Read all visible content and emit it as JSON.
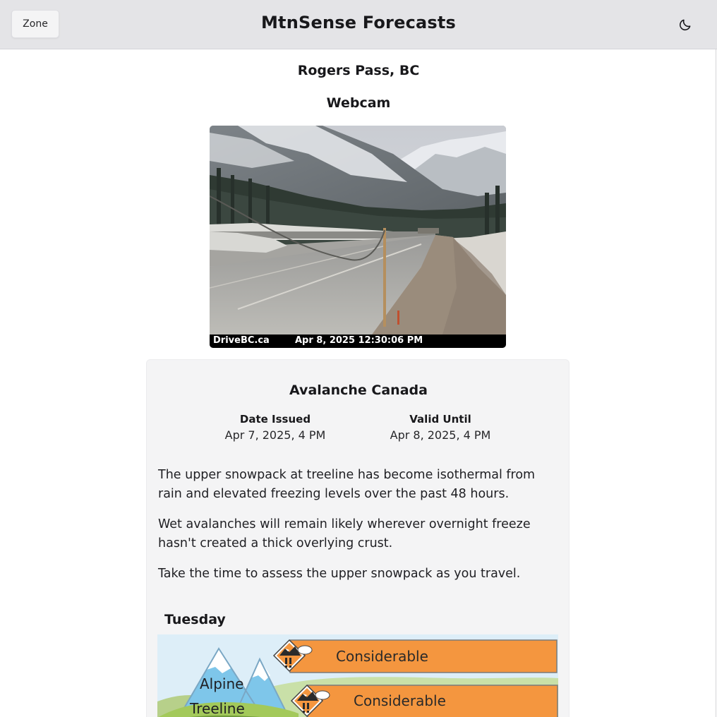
{
  "header": {
    "zone_button": "Zone",
    "title": "MtnSense Forecasts",
    "theme_icon": "moon-icon"
  },
  "location": "Rogers Pass, BC",
  "webcam": {
    "heading": "Webcam",
    "source": "DriveBC.ca",
    "timestamp": "Apr 8, 2025 12:30:06 PM"
  },
  "forecast": {
    "provider": "Avalanche Canada",
    "date_issued_label": "Date Issued",
    "date_issued": "Apr 7, 2025, 4 PM",
    "valid_until_label": "Valid Until",
    "valid_until": "Apr 8, 2025, 4 PM",
    "summary": [
      "The upper snowpack at treeline has become isothermal from rain and elevated freezing levels over the past 48 hours.",
      "Wet avalanches will remain likely wherever overnight freeze hasn't created a thick overlying crust.",
      "Take the time to assess the upper snowpack as you travel."
    ],
    "days": [
      {
        "day": "Tuesday",
        "bands": [
          {
            "elevation": "Alpine",
            "rating": "Considerable",
            "color": "#f4963f"
          },
          {
            "elevation": "Treeline",
            "rating": "Considerable",
            "color": "#f4963f"
          }
        ]
      }
    ]
  },
  "colors": {
    "header_bg": "#e4e4e7",
    "card_bg": "#f4f4f5",
    "considerable": "#f4963f"
  }
}
